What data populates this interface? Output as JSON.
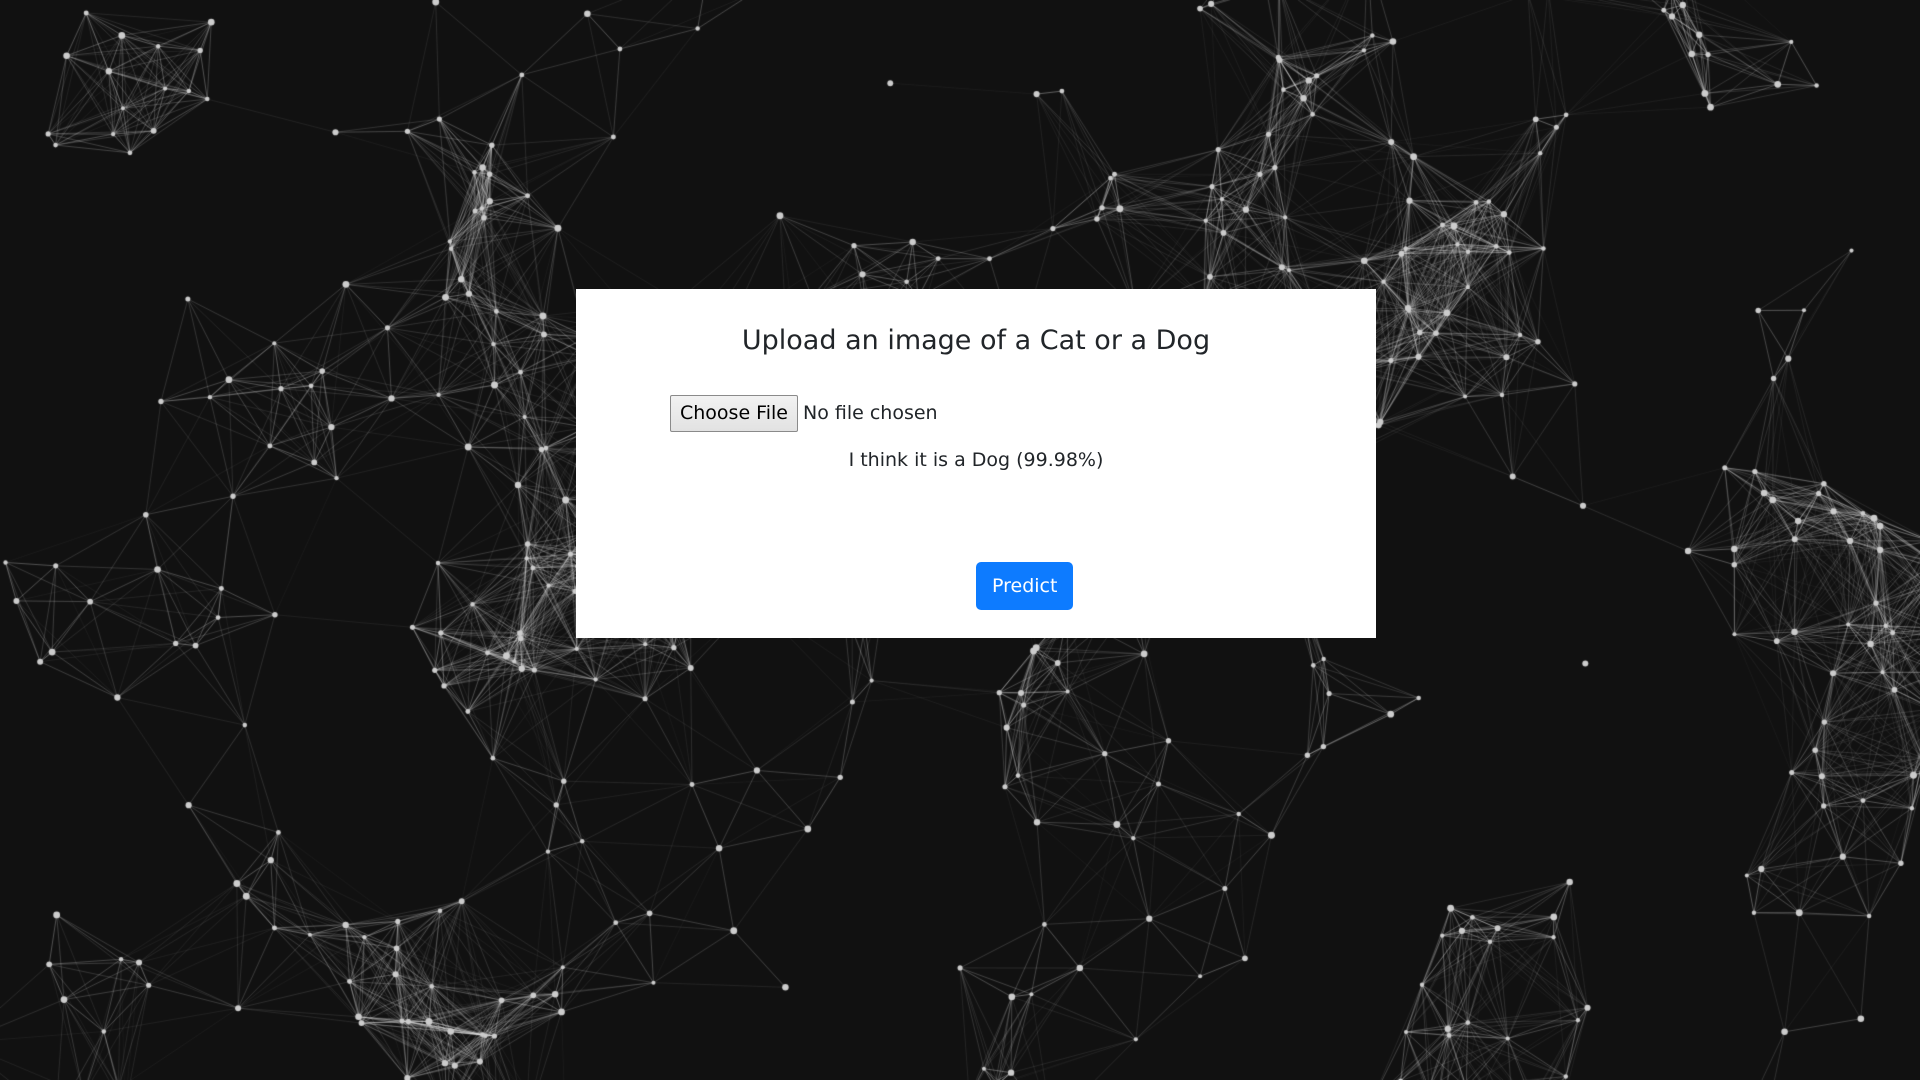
{
  "background": {
    "color": "#111111",
    "line_color": "#ffffff",
    "node_color": "#cccccc"
  },
  "card": {
    "title": "Upload an image of a Cat or a Dog",
    "file_input": {
      "button_label": "Choose File",
      "status": "No file chosen"
    },
    "prediction": "I think it is a Dog (99.98%)",
    "predict_label": "Predict",
    "accent": "#0d7bff"
  }
}
